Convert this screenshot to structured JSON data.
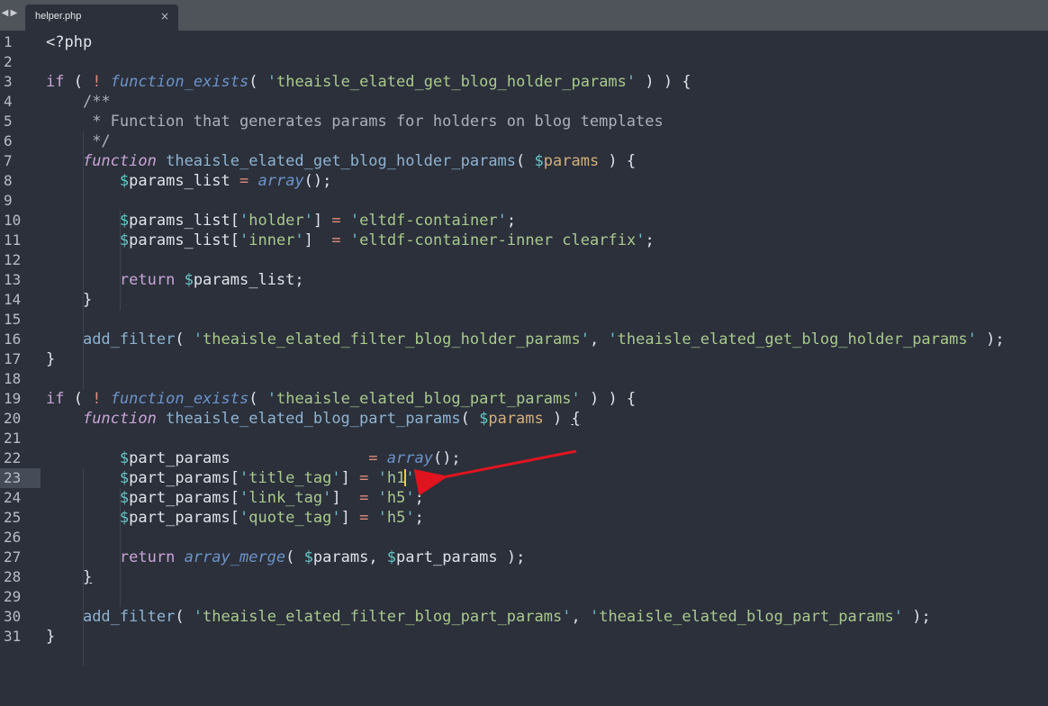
{
  "tabs": [
    {
      "label": "helper.php",
      "close": "×"
    }
  ],
  "nav": {
    "back": "◀",
    "forward": "▶"
  },
  "lines": [
    {
      "n": "1"
    },
    {
      "n": "2"
    },
    {
      "n": "3"
    },
    {
      "n": "4"
    },
    {
      "n": "5"
    },
    {
      "n": "6"
    },
    {
      "n": "7"
    },
    {
      "n": "8"
    },
    {
      "n": "9"
    },
    {
      "n": "10"
    },
    {
      "n": "11"
    },
    {
      "n": "12"
    },
    {
      "n": "13"
    },
    {
      "n": "14"
    },
    {
      "n": "15"
    },
    {
      "n": "16"
    },
    {
      "n": "17"
    },
    {
      "n": "18"
    },
    {
      "n": "19"
    },
    {
      "n": "20"
    },
    {
      "n": "21"
    },
    {
      "n": "22"
    },
    {
      "n": "23"
    },
    {
      "n": "24"
    },
    {
      "n": "25"
    },
    {
      "n": "26"
    },
    {
      "n": "27"
    },
    {
      "n": "28"
    },
    {
      "n": "29"
    },
    {
      "n": "30"
    },
    {
      "n": "31"
    }
  ],
  "code": {
    "l1": "<?php",
    "l3a": "if",
    "l3b": "!",
    "l3c": "function_exists",
    "l3d": "theaisle_elated_get_blog_holder_params",
    "l4": "/**",
    "l5": " * Function that generates params for holders on blog templates",
    "l6": " */",
    "l7a": "function",
    "l7b": "theaisle_elated_get_blog_holder_params",
    "l7c": "params",
    "l8a": "params_list",
    "l8b": "array",
    "l10a": "params_list",
    "l10b": "holder",
    "l10c": "eltdf-container",
    "l11a": "params_list",
    "l11b": "inner",
    "l11c": "eltdf-container-inner clearfix",
    "l13a": "return",
    "l13b": "params_list",
    "l16a": "add_filter",
    "l16b": "theaisle_elated_filter_blog_holder_params",
    "l16c": "theaisle_elated_get_blog_holder_params",
    "l19a": "if",
    "l19b": "!",
    "l19c": "function_exists",
    "l19d": "theaisle_elated_blog_part_params",
    "l20a": "function",
    "l20b": "theaisle_elated_blog_part_params",
    "l20c": "params",
    "l22a": "part_params",
    "l22b": "array",
    "l23a": "part_params",
    "l23b": "title_tag",
    "l23c": "h1",
    "l24a": "part_params",
    "l24b": "link_tag",
    "l24c": "h5",
    "l25a": "part_params",
    "l25b": "quote_tag",
    "l25c": "h5",
    "l27a": "return",
    "l27b": "array_merge",
    "l27c": "params",
    "l27d": "part_params",
    "l30a": "add_filter",
    "l30b": "theaisle_elated_filter_blog_part_params",
    "l30c": "theaisle_elated_blog_part_params"
  },
  "current_line": "23",
  "annotation": {
    "type": "red-arrow",
    "color": "#e0141e"
  },
  "colors": {
    "background": "#2b303b",
    "tabbar": "#4f535a",
    "keyword": "#c9a4d6",
    "string": "#a9c98c",
    "function_italic": "#6d93c8",
    "caret": "#f2c744"
  }
}
